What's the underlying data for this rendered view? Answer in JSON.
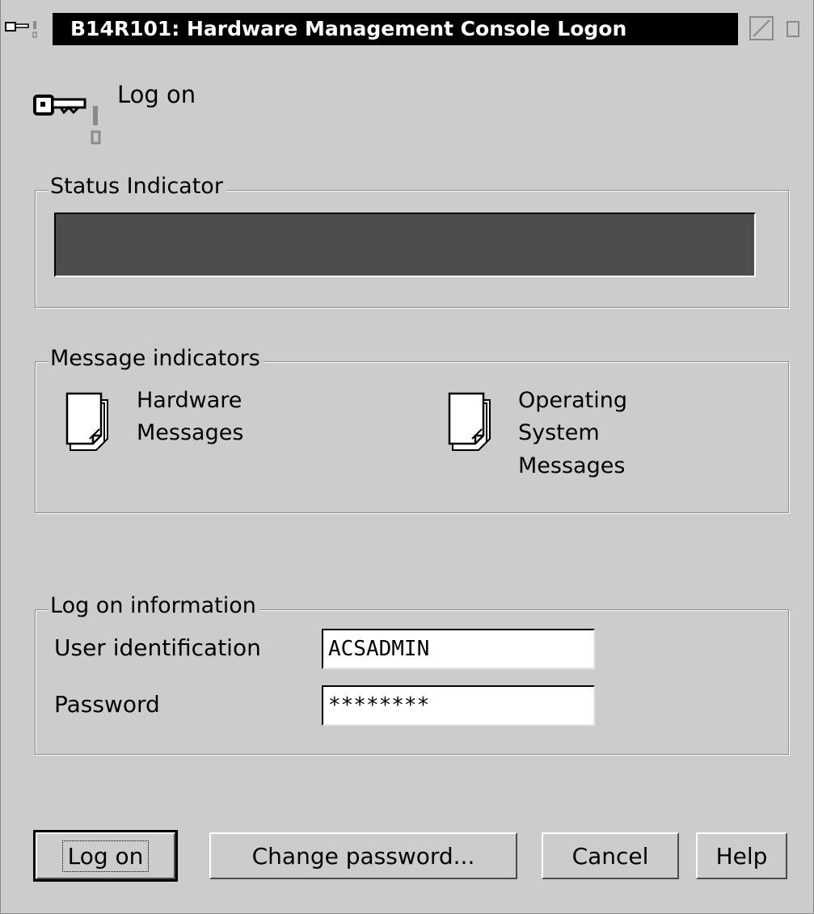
{
  "window": {
    "title": "B14R101: Hardware Management Console Logon",
    "heading": "Log on"
  },
  "status_indicator": {
    "label": "Status Indicator",
    "color": "#4d4d4d"
  },
  "message_indicators": {
    "label": "Message indicators",
    "hardware": {
      "line1": "Hardware",
      "line2": "Messages",
      "icon": "document-stack-icon"
    },
    "operating_system": {
      "line1": "Operating",
      "line2": "System",
      "line3": "Messages",
      "icon": "document-stack-icon"
    }
  },
  "logon_info": {
    "label": "Log on information",
    "user_label": "User identification",
    "user_value": "ACSADMIN",
    "password_label": "Password",
    "password_value": "********"
  },
  "buttons": {
    "logon": "Log on",
    "change_password": "Change password...",
    "cancel": "Cancel",
    "help": "Help"
  },
  "colors": {
    "titlebar_bg": "#000000",
    "dialog_bg": "#cccccc"
  }
}
